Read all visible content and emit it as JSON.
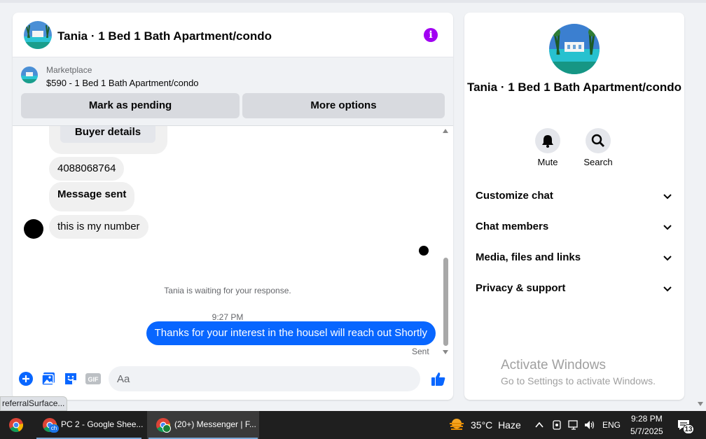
{
  "chat": {
    "title": "Tania · 1 Bed 1 Bath Apartment/condo",
    "marketplace_label": "Marketplace",
    "listing": "$590 - 1 Bed 1 Bath Apartment/condo",
    "mark_pending": "Mark as pending",
    "more_options": "More options",
    "buyer_details": "Buyer details",
    "messages": {
      "phone": "4088068764",
      "sent_msg": "Message sent",
      "my_number": "this is my number"
    },
    "waiting_note": "Tania is waiting for your response.",
    "time": "9:27 PM",
    "outgoing": "Thanks for your interest in the housel will reach out Shortly",
    "sent_status": "Sent",
    "input_placeholder": "Aa",
    "icons": [
      "plus-circle-icon",
      "photo-icon",
      "sticker-icon",
      "gif-icon",
      "emoji-icon",
      "thumbs-up-icon",
      "info-icon"
    ]
  },
  "side": {
    "name": "Tania · 1 Bed 1 Bath Apartment/condo",
    "mute": "Mute",
    "search": "Search",
    "sections": [
      "Customize chat",
      "Chat members",
      "Media, files and links",
      "Privacy & support"
    ]
  },
  "watermark": {
    "line1": "Activate Windows",
    "line2": "Go to Settings to activate Windows."
  },
  "status_bar": "referralSurface...",
  "taskbar": {
    "app1": "PC 2 - Google Shee...",
    "app2": "(20+) Messenger | F...",
    "badge1": "ch",
    "temperature": "35°C",
    "weather": "Haze",
    "language": "ENG",
    "time": "9:28 PM",
    "date": "5/7/2025",
    "notifications": "13"
  },
  "colors": {
    "accent_blue": "#0866ff",
    "info_purple": "#a100f2",
    "bubble_grey": "#f0f0f0",
    "taskbar": "#1f1f1f"
  }
}
